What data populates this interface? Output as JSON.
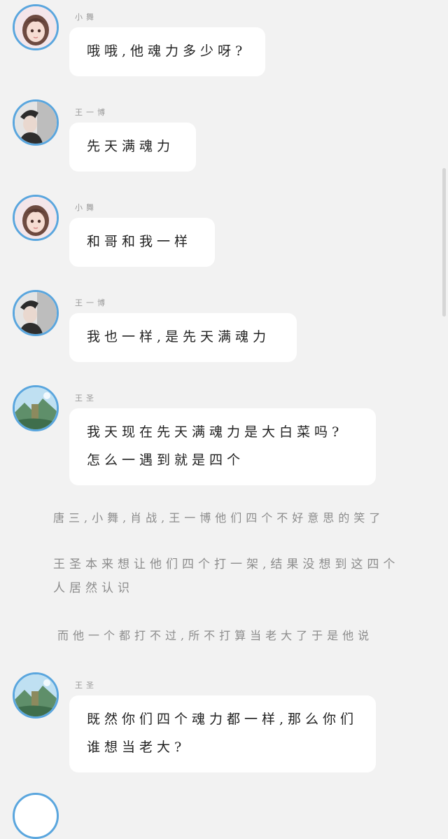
{
  "messages": [
    {
      "sender": "小舞",
      "avatar": "girl-avatar-icon",
      "text": "哦哦,他魂力多少呀?"
    },
    {
      "sender": "王一博",
      "avatar": "man-avatar-icon",
      "text": "先天满魂力"
    },
    {
      "sender": "小舞",
      "avatar": "girl-avatar-icon",
      "text": "和哥和我一样"
    },
    {
      "sender": "王一博",
      "avatar": "man-avatar-icon",
      "text": "我也一样,是先天满魂力"
    },
    {
      "sender": "王圣",
      "avatar": "landscape-avatar-icon",
      "text": "我天现在先天满魂力是大白菜吗?怎么一遇到就是四个"
    },
    {
      "sender": "王圣",
      "avatar": "landscape-avatar-icon",
      "text": "既然你们四个魂力都一样,那么你们谁想当老大?"
    }
  ],
  "narration": [
    "唐三,小舞,肖战,王一博他们四个不好意思的笑了",
    "王圣本来想让他们四个打一架,结果没想到这四个人居然认识",
    "而他一个都打不过,所不打算当老大了于是他说"
  ],
  "colors": {
    "background": "#f2f2f2",
    "bubble": "#ffffff",
    "avatar_border": "#5aa6de",
    "narration_text": "#8c8c8c"
  }
}
